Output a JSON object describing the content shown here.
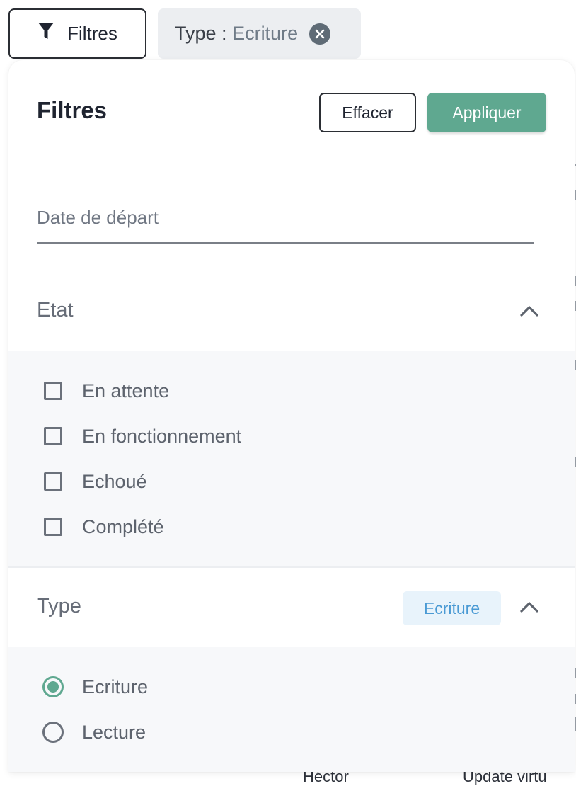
{
  "toolbar": {
    "filters_button_label": "Filtres",
    "active_chip": {
      "key": "Type :",
      "value": "Ecriture"
    }
  },
  "panel": {
    "title": "Filtres",
    "clear_label": "Effacer",
    "apply_label": "Appliquer",
    "date_field": {
      "placeholder": "Date de départ",
      "value": ""
    },
    "etat": {
      "label": "Etat",
      "expanded": true,
      "options": [
        {
          "label": "En attente",
          "checked": false
        },
        {
          "label": "En fonctionnement",
          "checked": false
        },
        {
          "label": "Echoué",
          "checked": false
        },
        {
          "label": "Complété",
          "checked": false
        }
      ]
    },
    "type": {
      "label": "Type",
      "badge": "Ecriture",
      "expanded": true,
      "options": [
        {
          "label": "Ecriture",
          "selected": true
        },
        {
          "label": "Lecture",
          "selected": false
        }
      ]
    }
  },
  "background": {
    "partial_texts": [
      "Héctor",
      "Update virtu"
    ]
  },
  "colors": {
    "accent": "#5fa890",
    "badge_text": "#4a9ad4",
    "badge_bg": "#e8f3fb",
    "chip_bg": "#eceef1",
    "section_bg": "#f7f8fa"
  }
}
